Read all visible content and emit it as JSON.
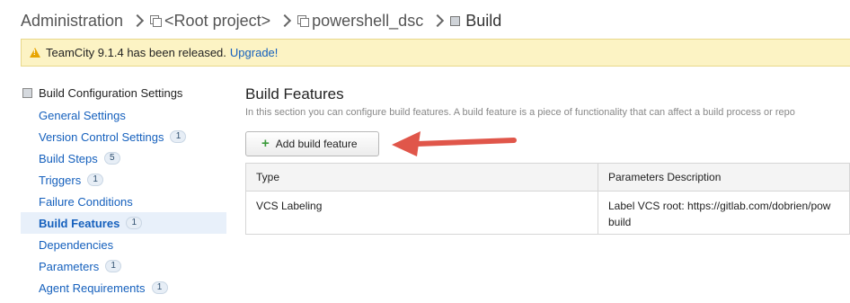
{
  "breadcrumb": {
    "items": [
      "Administration",
      "<Root project>",
      "powershell_dsc",
      "Build"
    ]
  },
  "notice": {
    "text": "TeamCity 9.1.4 has been released.",
    "link": "Upgrade!"
  },
  "sidebar": {
    "title": "Build Configuration Settings",
    "items": [
      {
        "label": "General Settings",
        "badge": ""
      },
      {
        "label": "Version Control Settings",
        "badge": "1"
      },
      {
        "label": "Build Steps",
        "badge": "5"
      },
      {
        "label": "Triggers",
        "badge": "1"
      },
      {
        "label": "Failure Conditions",
        "badge": ""
      },
      {
        "label": "Build Features",
        "badge": "1",
        "active": true
      },
      {
        "label": "Dependencies",
        "badge": ""
      },
      {
        "label": "Parameters",
        "badge": "1"
      },
      {
        "label": "Agent Requirements",
        "badge": "1"
      }
    ]
  },
  "main": {
    "title": "Build Features",
    "description": "In this section you can configure build features. A build feature is a piece of functionality that can affect a build process or repo",
    "add_button": "Add build feature",
    "table": {
      "headers": [
        "Type",
        "Parameters Description"
      ],
      "rows": [
        [
          "VCS Labeling",
          "Label VCS root: https://gitlab.com/dobrien/pow\nbuild"
        ]
      ]
    }
  },
  "colors": {
    "link": "#1560bd",
    "notice_bg": "#fcf3c4",
    "arrow": "#e0564a",
    "active_bg": "#e8f0fa"
  }
}
